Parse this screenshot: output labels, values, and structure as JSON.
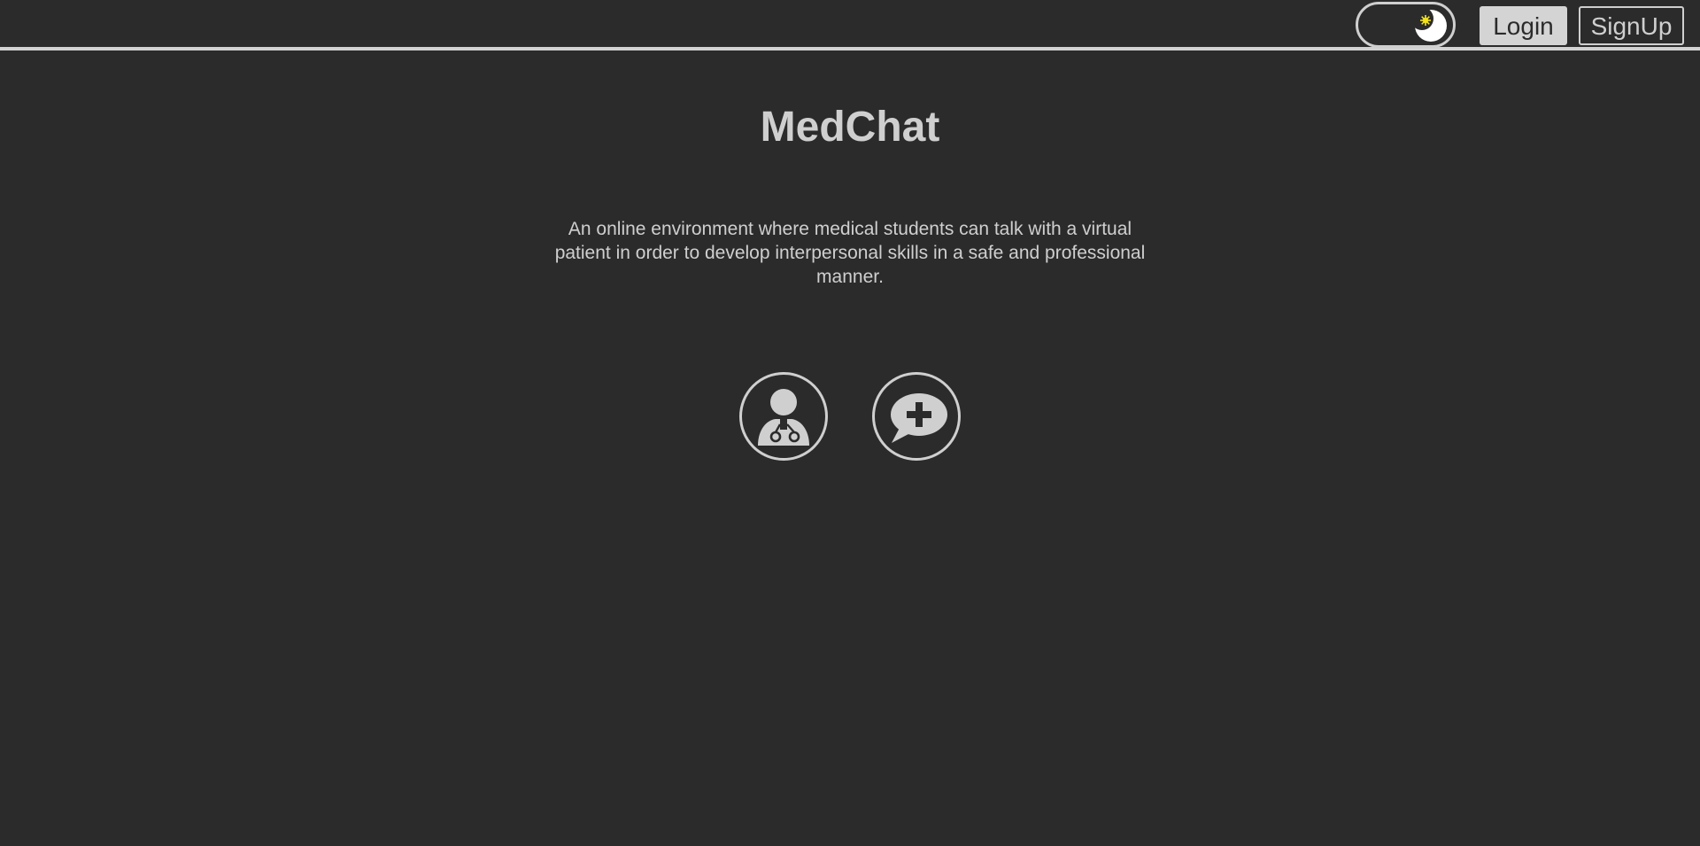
{
  "header": {
    "theme_toggle": {
      "icon": "moon-icon",
      "state": "dark"
    },
    "login_label": "Login",
    "signup_label": "SignUp"
  },
  "main": {
    "title": "MedChat",
    "description": "An online environment where medical students can talk with a virtual patient in order to develop interpersonal skills in a safe and professional manner.",
    "actions": [
      {
        "icon": "doctor-icon"
      },
      {
        "icon": "medical-chat-icon"
      }
    ]
  },
  "colors": {
    "background": "#2b2b2b",
    "foreground": "#cfcfcf",
    "sun_accent": "#f2e21b"
  }
}
